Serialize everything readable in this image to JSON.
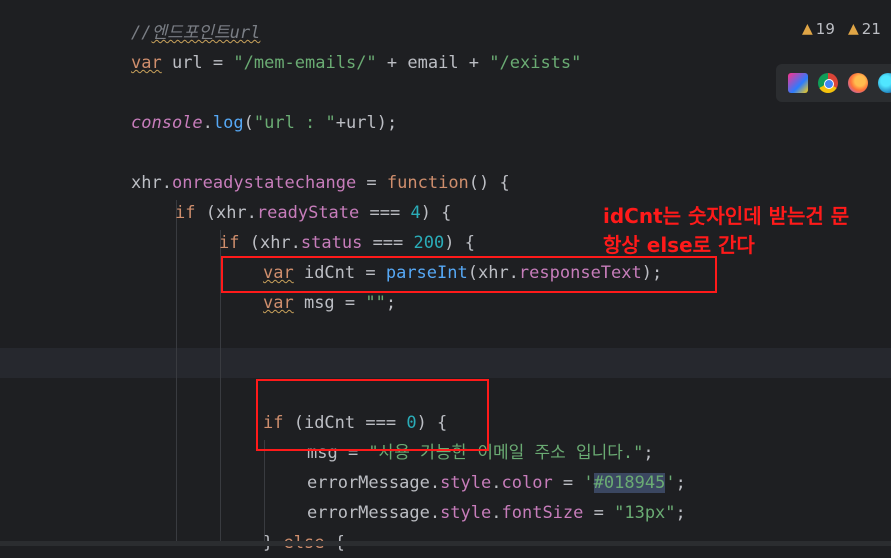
{
  "editor": {
    "lines": [
      {
        "id": "comment",
        "segs": [
          {
            "t": "//",
            "c": "com"
          },
          {
            "t": "엔드포인트url",
            "c": "com com-u"
          }
        ]
      },
      {
        "id": "var-url",
        "segs": [
          {
            "t": "var",
            "c": "kw-u"
          },
          {
            "t": " url = ",
            "c": "plain"
          },
          {
            "t": "\"/mem-emails/\"",
            "c": "str"
          },
          {
            "t": " + email + ",
            "c": "plain"
          },
          {
            "t": "\"/exists\"",
            "c": "str"
          }
        ]
      },
      {
        "id": "blank1",
        "segs": []
      },
      {
        "id": "console-log",
        "segs": [
          {
            "t": "console",
            "c": "prop ital"
          },
          {
            "t": ".",
            "c": "plain"
          },
          {
            "t": "log",
            "c": "fn"
          },
          {
            "t": "(",
            "c": "plain"
          },
          {
            "t": "\"url : \"",
            "c": "str"
          },
          {
            "t": "+url);",
            "c": "plain"
          }
        ]
      },
      {
        "id": "blank2",
        "segs": []
      },
      {
        "id": "onready",
        "segs": [
          {
            "t": "xhr.",
            "c": "plain"
          },
          {
            "t": "onreadystatechange",
            "c": "prop"
          },
          {
            "t": " = ",
            "c": "plain"
          },
          {
            "t": "function",
            "c": "kw"
          },
          {
            "t": "() {",
            "c": "plain"
          }
        ]
      },
      {
        "id": "if-ready",
        "segs": [
          {
            "t": "if",
            "c": "kw"
          },
          {
            "t": " (xhr.",
            "c": "plain"
          },
          {
            "t": "readyState",
            "c": "prop"
          },
          {
            "t": " === ",
            "c": "plain"
          },
          {
            "t": "4",
            "c": "num"
          },
          {
            "t": ") {",
            "c": "plain"
          }
        ]
      },
      {
        "id": "if-status",
        "segs": [
          {
            "t": "if",
            "c": "kw"
          },
          {
            "t": " (xhr.",
            "c": "plain"
          },
          {
            "t": "status",
            "c": "prop"
          },
          {
            "t": " === ",
            "c": "plain"
          },
          {
            "t": "200",
            "c": "num"
          },
          {
            "t": ") {",
            "c": "plain"
          }
        ]
      },
      {
        "id": "var-idcnt",
        "segs": [
          {
            "t": "var",
            "c": "kw-u"
          },
          {
            "t": " idCnt = ",
            "c": "plain"
          },
          {
            "t": "parseInt",
            "c": "fn"
          },
          {
            "t": "(xhr.",
            "c": "plain"
          },
          {
            "t": "responseText",
            "c": "prop"
          },
          {
            "t": ");",
            "c": "plain"
          }
        ]
      },
      {
        "id": "var-msg",
        "segs": [
          {
            "t": "var",
            "c": "kw-u"
          },
          {
            "t": " msg = ",
            "c": "plain"
          },
          {
            "t": "\"\"",
            "c": "str"
          },
          {
            "t": ";",
            "c": "plain"
          }
        ]
      },
      {
        "id": "blank3",
        "segs": []
      },
      {
        "id": "blank4",
        "segs": []
      },
      {
        "id": "blank5",
        "segs": []
      },
      {
        "id": "if-idcnt",
        "segs": [
          {
            "t": "if",
            "c": "kw"
          },
          {
            "t": " (idCnt === ",
            "c": "plain"
          },
          {
            "t": "0",
            "c": "num"
          },
          {
            "t": ") {",
            "c": "plain"
          }
        ]
      },
      {
        "id": "msg-assign",
        "segs": [
          {
            "t": "msg = ",
            "c": "plain"
          },
          {
            "t": "\"사용 가능한 이메일 주소 입니다.\"",
            "c": "str"
          },
          {
            "t": ";",
            "c": "plain"
          }
        ]
      },
      {
        "id": "err-color",
        "segs": [
          {
            "t": "errorMessage.",
            "c": "plain"
          },
          {
            "t": "style",
            "c": "prop"
          },
          {
            "t": ".",
            "c": "plain"
          },
          {
            "t": "color",
            "c": "prop"
          },
          {
            "t": " = ",
            "c": "plain"
          },
          {
            "t": "'",
            "c": "str"
          },
          {
            "t": "#018945",
            "c": "hex-hl"
          },
          {
            "t": "'",
            "c": "str"
          },
          {
            "t": ";",
            "c": "plain"
          }
        ]
      },
      {
        "id": "err-font",
        "segs": [
          {
            "t": "errorMessage.",
            "c": "plain"
          },
          {
            "t": "style",
            "c": "prop"
          },
          {
            "t": ".",
            "c": "plain"
          },
          {
            "t": "fontSize",
            "c": "prop"
          },
          {
            "t": " = ",
            "c": "plain"
          },
          {
            "t": "\"13px\"",
            "c": "str"
          },
          {
            "t": ";",
            "c": "plain"
          }
        ]
      },
      {
        "id": "else",
        "segs": [
          {
            "t": "} ",
            "c": "plain"
          },
          {
            "t": "else",
            "c": "kw"
          },
          {
            "t": " {",
            "c": "plain"
          }
        ]
      }
    ]
  },
  "annotation": {
    "line1": "idCnt는 숫자인데 받는건 문",
    "line2": "항상 else로 간다"
  },
  "inspections": {
    "warnings_a": "19",
    "warnings_b": "21"
  },
  "browsers": [
    "jetbrains-icon",
    "chrome-icon",
    "firefox-icon",
    "edge-icon"
  ],
  "colors": {
    "annotation_red": "#ff1a1a",
    "background": "#1e1f22"
  }
}
